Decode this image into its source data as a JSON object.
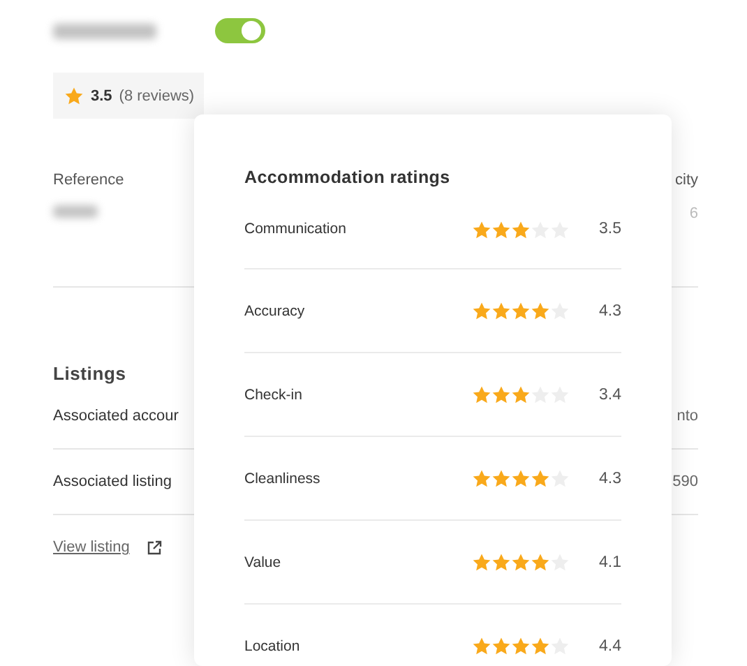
{
  "header": {
    "toggle": {
      "on": true
    }
  },
  "rating_chip": {
    "score": "3.5",
    "reviews": "(8 reviews)"
  },
  "details": {
    "label": "Reference",
    "right_label": "city",
    "right_value": "6"
  },
  "listings": {
    "title": "Listings",
    "rows": [
      {
        "label": "Associated accour",
        "value": "nto"
      },
      {
        "label": "Associated listing",
        "value": "590"
      }
    ],
    "link": "View listing"
  },
  "popover": {
    "title": "Accommodation ratings",
    "ratings": [
      {
        "name": "Communication",
        "stars": 3,
        "value": "3.5"
      },
      {
        "name": "Accuracy",
        "stars": 4,
        "value": "4.3"
      },
      {
        "name": "Check-in",
        "stars": 3,
        "value": "3.4"
      },
      {
        "name": "Cleanliness",
        "stars": 4,
        "value": "4.3"
      },
      {
        "name": "Value",
        "stars": 4,
        "value": "4.1"
      },
      {
        "name": "Location",
        "stars": 4,
        "value": "4.4"
      }
    ]
  }
}
